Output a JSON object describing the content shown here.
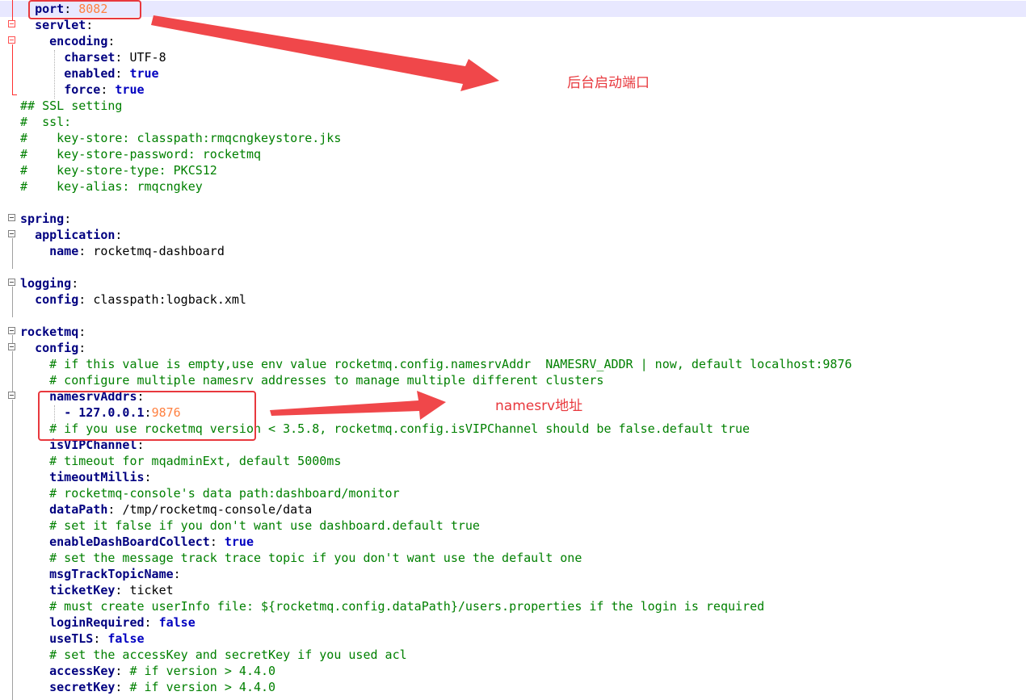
{
  "editor": {
    "lines": [
      [
        {
          "t": "  "
        },
        {
          "t": "port",
          "c": "k"
        },
        {
          "t": ": ",
          "c": "p"
        },
        {
          "t": "8082",
          "c": "n"
        }
      ],
      [
        {
          "t": "  "
        },
        {
          "t": "servlet",
          "c": "k"
        },
        {
          "t": ":",
          "c": "p"
        }
      ],
      [
        {
          "t": "    "
        },
        {
          "t": "encoding",
          "c": "k"
        },
        {
          "t": ":",
          "c": "p"
        }
      ],
      [
        {
          "t": "      "
        },
        {
          "t": "charset",
          "c": "k"
        },
        {
          "t": ": ",
          "c": "p"
        },
        {
          "t": "UTF-8",
          "c": "v"
        }
      ],
      [
        {
          "t": "      "
        },
        {
          "t": "enabled",
          "c": "k"
        },
        {
          "t": ": ",
          "c": "p"
        },
        {
          "t": "true",
          "c": "vb"
        }
      ],
      [
        {
          "t": "      "
        },
        {
          "t": "force",
          "c": "k"
        },
        {
          "t": ": ",
          "c": "p"
        },
        {
          "t": "true",
          "c": "vb"
        }
      ],
      [
        {
          "t": "## SSL setting",
          "c": "c"
        }
      ],
      [
        {
          "t": "#  ssl:",
          "c": "c"
        }
      ],
      [
        {
          "t": "#    key-store: classpath:rmqcngkeystore.jks",
          "c": "c"
        }
      ],
      [
        {
          "t": "#    key-store-password: rocketmq",
          "c": "c"
        }
      ],
      [
        {
          "t": "#    key-store-type: PKCS12",
          "c": "c"
        }
      ],
      [
        {
          "t": "#    key-alias: rmqcngkey",
          "c": "c"
        }
      ],
      [],
      [
        {
          "t": "spring",
          "c": "k"
        },
        {
          "t": ":",
          "c": "p"
        }
      ],
      [
        {
          "t": "  "
        },
        {
          "t": "application",
          "c": "k"
        },
        {
          "t": ":",
          "c": "p"
        }
      ],
      [
        {
          "t": "    "
        },
        {
          "t": "name",
          "c": "k"
        },
        {
          "t": ": ",
          "c": "p"
        },
        {
          "t": "rocketmq-dashboard",
          "c": "v"
        }
      ],
      [],
      [
        {
          "t": "logging",
          "c": "k"
        },
        {
          "t": ":",
          "c": "p"
        }
      ],
      [
        {
          "t": "  "
        },
        {
          "t": "config",
          "c": "k"
        },
        {
          "t": ": ",
          "c": "p"
        },
        {
          "t": "classpath:logback.xml",
          "c": "v"
        }
      ],
      [],
      [
        {
          "t": "rocketmq",
          "c": "k"
        },
        {
          "t": ":",
          "c": "p"
        }
      ],
      [
        {
          "t": "  "
        },
        {
          "t": "config",
          "c": "k"
        },
        {
          "t": ":",
          "c": "p"
        }
      ],
      [
        {
          "t": "    "
        },
        {
          "t": "# if this value is empty,use env value rocketmq.config.namesrvAddr  NAMESRV_ADDR | now, default localhost:9876",
          "c": "c"
        }
      ],
      [
        {
          "t": "    "
        },
        {
          "t": "# configure multiple namesrv addresses to manage multiple different clusters",
          "c": "c"
        }
      ],
      [
        {
          "t": "    "
        },
        {
          "t": "namesrvAddrs",
          "c": "k"
        },
        {
          "t": ":",
          "c": "p"
        }
      ],
      [
        {
          "t": "      "
        },
        {
          "t": "- ",
          "c": "k"
        },
        {
          "t": "127.0.0.1",
          "c": "k"
        },
        {
          "t": ":",
          "c": "p"
        },
        {
          "t": "9876",
          "c": "n"
        }
      ],
      [
        {
          "t": "    "
        },
        {
          "t": "# if you use rocketmq version < 3.5.8, rocketmq.config.isVIPChannel should be false.default true",
          "c": "c"
        }
      ],
      [
        {
          "t": "    "
        },
        {
          "t": "isVIPChannel",
          "c": "k"
        },
        {
          "t": ":",
          "c": "p"
        }
      ],
      [
        {
          "t": "    "
        },
        {
          "t": "# timeout for mqadminExt, default 5000ms",
          "c": "c"
        }
      ],
      [
        {
          "t": "    "
        },
        {
          "t": "timeoutMillis",
          "c": "k"
        },
        {
          "t": ":",
          "c": "p"
        }
      ],
      [
        {
          "t": "    "
        },
        {
          "t": "# rocketmq-console's data path:dashboard/monitor",
          "c": "c"
        }
      ],
      [
        {
          "t": "    "
        },
        {
          "t": "dataPath",
          "c": "k"
        },
        {
          "t": ": ",
          "c": "p"
        },
        {
          "t": "/tmp/rocketmq-console/data",
          "c": "v"
        }
      ],
      [
        {
          "t": "    "
        },
        {
          "t": "# set it false if you don't want use dashboard.default true",
          "c": "c"
        }
      ],
      [
        {
          "t": "    "
        },
        {
          "t": "enableDashBoardCollect",
          "c": "k"
        },
        {
          "t": ": ",
          "c": "p"
        },
        {
          "t": "true",
          "c": "vb"
        }
      ],
      [
        {
          "t": "    "
        },
        {
          "t": "# set the message track trace topic if you don't want use the default one",
          "c": "c"
        }
      ],
      [
        {
          "t": "    "
        },
        {
          "t": "msgTrackTopicName",
          "c": "k"
        },
        {
          "t": ":",
          "c": "p"
        }
      ],
      [
        {
          "t": "    "
        },
        {
          "t": "ticketKey",
          "c": "k"
        },
        {
          "t": ": ",
          "c": "p"
        },
        {
          "t": "ticket",
          "c": "v"
        }
      ],
      [
        {
          "t": "    "
        },
        {
          "t": "# must create userInfo file: ${rocketmq.config.dataPath}/users.properties if the login is required",
          "c": "c"
        }
      ],
      [
        {
          "t": "    "
        },
        {
          "t": "loginRequired",
          "c": "k"
        },
        {
          "t": ": ",
          "c": "p"
        },
        {
          "t": "false",
          "c": "vb"
        }
      ],
      [
        {
          "t": "    "
        },
        {
          "t": "useTLS",
          "c": "k"
        },
        {
          "t": ": ",
          "c": "p"
        },
        {
          "t": "false",
          "c": "vb"
        }
      ],
      [
        {
          "t": "    "
        },
        {
          "t": "# set the accessKey and secretKey if you used acl",
          "c": "c"
        }
      ],
      [
        {
          "t": "    "
        },
        {
          "t": "accessKey",
          "c": "k"
        },
        {
          "t": ": ",
          "c": "p"
        },
        {
          "t": "# if version > 4.4.0",
          "c": "c"
        }
      ],
      [
        {
          "t": "    "
        },
        {
          "t": "secretKey",
          "c": "k"
        },
        {
          "t": ": ",
          "c": "p"
        },
        {
          "t": "# if version > 4.4.0",
          "c": "c"
        }
      ]
    ]
  },
  "annotations": {
    "port_note": "后台启动端口",
    "namesrv_note": "namesrv地址"
  },
  "colors": {
    "key": "#000080",
    "comment": "#008000",
    "number": "#ff8040",
    "boolean": "#0000c0",
    "annotation": "#e8383d",
    "current_line": "#e8e8ff"
  },
  "icons": {
    "fold_marker": "minus-box-icon",
    "arrow": "red-arrow-icon"
  }
}
